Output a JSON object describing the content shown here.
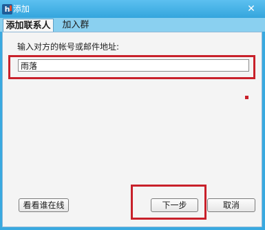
{
  "window": {
    "title": "添加",
    "logo_text": "h",
    "close_symbol": "✕"
  },
  "tabs": [
    {
      "label": "添加联系人",
      "active": true
    },
    {
      "label": "加入群",
      "active": false
    }
  ],
  "form": {
    "prompt": "输入对方的帐号或邮件地址:",
    "input_value": "雨落"
  },
  "buttons": {
    "online": "看看谁在线",
    "next": "下一步",
    "cancel": "取消"
  },
  "colors": {
    "title_bar": "#39a9e0",
    "highlight": "#c8202a"
  }
}
